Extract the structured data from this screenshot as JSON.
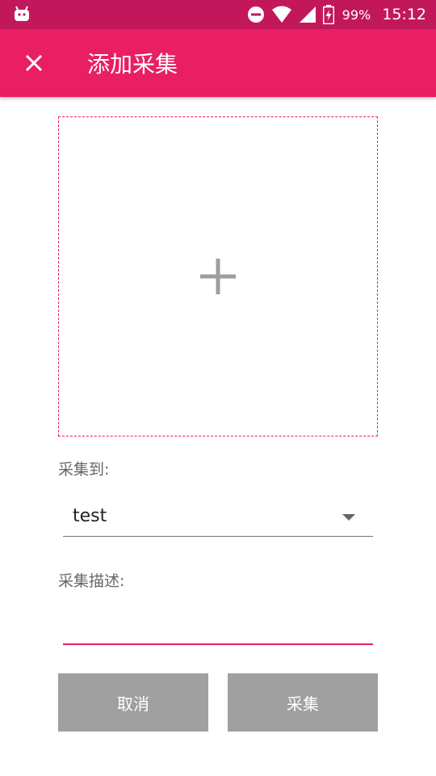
{
  "status_bar": {
    "battery_percent": "99%",
    "time": "15:12",
    "icons": [
      "android-debug-icon",
      "do-not-disturb-icon",
      "wifi-icon",
      "cell-signal-icon",
      "battery-charging-icon"
    ]
  },
  "app_bar": {
    "title": "添加采集",
    "close_icon": "close-icon"
  },
  "image_picker": {
    "icon": "plus-icon"
  },
  "form": {
    "target_label": "采集到:",
    "target_value": "test",
    "description_label": "采集描述:",
    "description_value": ""
  },
  "buttons": {
    "cancel_label": "取消",
    "collect_label": "采集"
  },
  "colors": {
    "status_bar": "#c2185b",
    "primary": "#e91e63",
    "button_disabled": "#a0a0a0"
  }
}
